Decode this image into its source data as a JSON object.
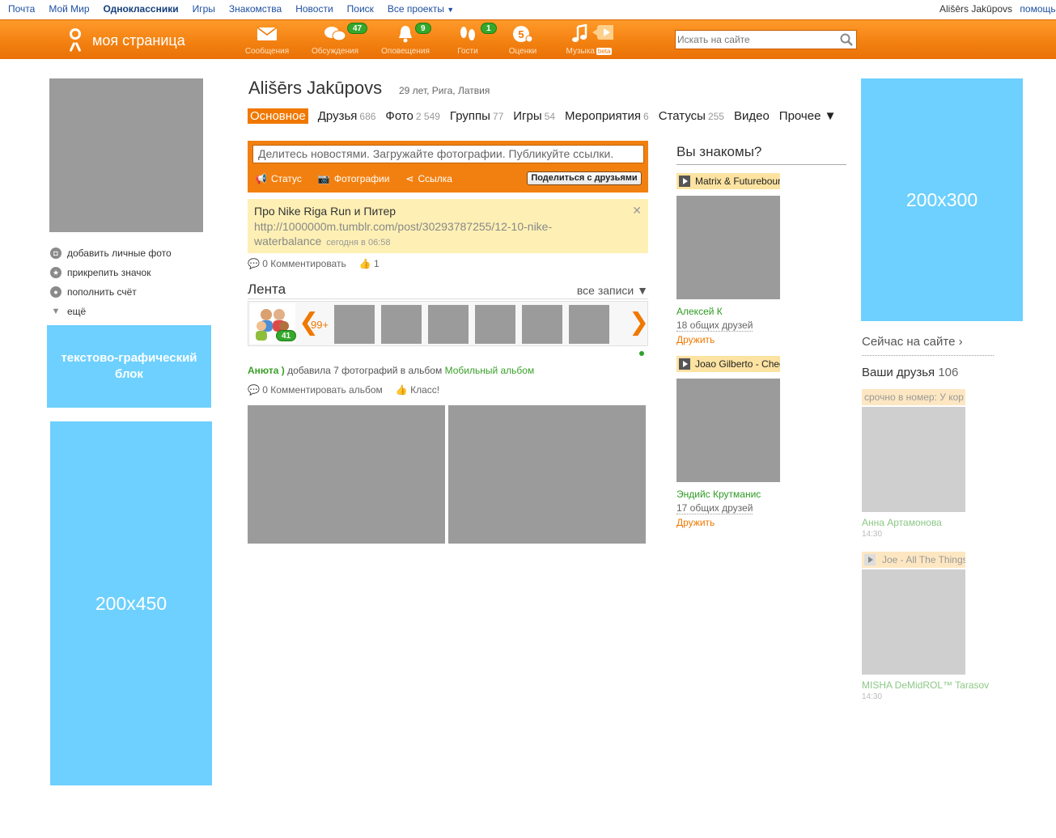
{
  "portal": {
    "links": [
      "Почта",
      "Мой Мир",
      "Одноклассники",
      "Игры",
      "Знакомства",
      "Новости",
      "Поиск",
      "Все проекты"
    ],
    "active": "Одноклассники",
    "user_name": "Ališērs Jakūpovs",
    "help": "помощь"
  },
  "toolbar": {
    "logo_text": "моя страница",
    "items": [
      {
        "label": "Сообщения",
        "icon": "envelope-icon",
        "badge": ""
      },
      {
        "label": "Обсуждения",
        "icon": "discussion-icon",
        "badge": "47"
      },
      {
        "label": "Оповещения",
        "icon": "bell-icon",
        "badge": "9"
      },
      {
        "label": "Гости",
        "icon": "footprints-icon",
        "badge": "1"
      },
      {
        "label": "Оценки",
        "icon": "rating-icon",
        "badge": ""
      },
      {
        "label": "Музыка",
        "icon": "music-icon",
        "badge": "",
        "tag": "beta"
      }
    ],
    "search_placeholder": "Искать на сайте"
  },
  "left": {
    "menu": [
      "добавить личные фото",
      "прикрепить значок",
      "пополнить счёт",
      "ещё"
    ],
    "ad_text": "текстово-графический блок",
    "ad_450": "200x450"
  },
  "profile": {
    "name": "Ališērs Jakūpovs",
    "info": "29 лет, Рига, Латвия",
    "nav": [
      {
        "label": "Основное",
        "count": ""
      },
      {
        "label": "Друзья",
        "count": "686"
      },
      {
        "label": "Фото",
        "count": "2 549"
      },
      {
        "label": "Группы",
        "count": "77"
      },
      {
        "label": "Игры",
        "count": "54"
      },
      {
        "label": "Мероприятия",
        "count": "6"
      },
      {
        "label": "Статусы",
        "count": "255"
      },
      {
        "label": "Видео",
        "count": ""
      },
      {
        "label": "Прочее ▼",
        "count": ""
      }
    ]
  },
  "share": {
    "placeholder": "Делитесь новостями. Загружайте фотографии. Публикуйте ссылки.",
    "actions": [
      "Статус",
      "Фотографии",
      "Ссылка"
    ],
    "button": "Поделиться с друзьями"
  },
  "status": {
    "title": "Про Nike Riga Run и Питер",
    "url": "http://1000000m.tumblr.com/post/30293787255/12-10-nike-waterbalance",
    "time": "сегодня в 06:58",
    "comment": "0 Комментировать",
    "likes": "1"
  },
  "feed": {
    "title": "Лента",
    "all": "все записи ▼",
    "group_badge": "41",
    "count": "99+",
    "activity_user": "Анюта )",
    "activity_text": " добавила 7 фотографий в альбом ",
    "activity_album": "Мобильный альбом",
    "album_comment": "0 Комментировать альбом",
    "album_like": "Класс!"
  },
  "suggest": {
    "title": "Вы знакомы?",
    "people": [
      {
        "music": "Matrix & Futurebound",
        "name": "Алексей К",
        "mutual": "18 общих друзей",
        "action": "Дружить"
      },
      {
        "music": "Joao Gilberto - Chega de Saudade",
        "name": "Эндийс Крутманис",
        "mutual": "17 общих друзей",
        "action": "Дружить"
      }
    ]
  },
  "right": {
    "ad_300": "200x300",
    "online": "Сейчас на сайте ›",
    "friends_title": "Ваши друзья",
    "friends_count": "106",
    "friends": [
      {
        "note": "срочно в номер: У кор",
        "name": "Анна Артамонова",
        "time": "14:30",
        "play": false
      },
      {
        "note": "Joe - All The Things",
        "name": "MISHA DeMidROL™ Tarasov",
        "time": "14:30",
        "play": true
      }
    ]
  },
  "colors": {
    "brand_orange": "#f07800",
    "ad_blue": "#6dd0fe",
    "link_green": "#2e9a24",
    "badge_green": "#35a82b"
  }
}
